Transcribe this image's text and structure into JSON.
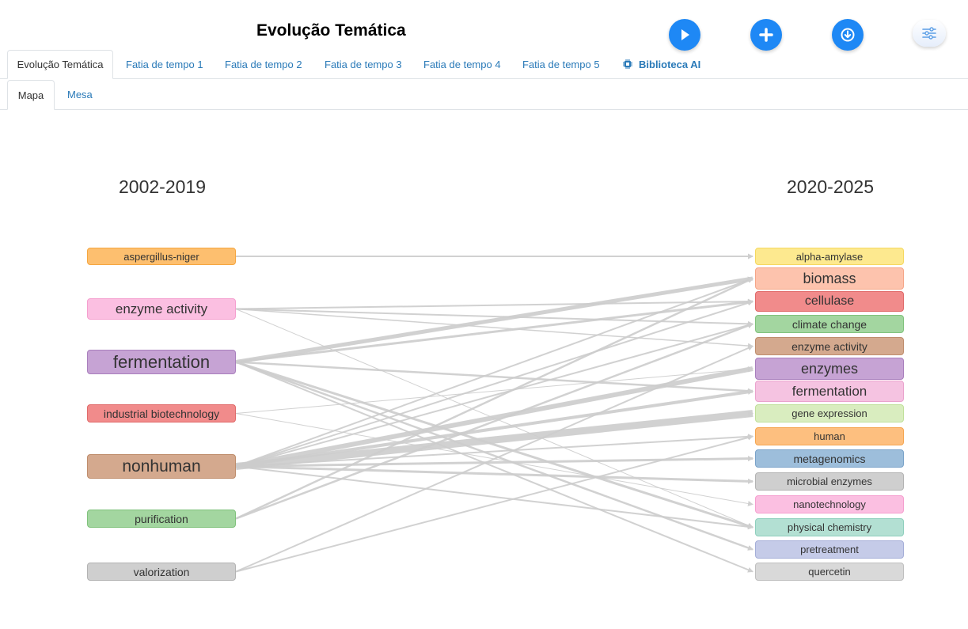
{
  "header": {
    "title": "Evolução Temática"
  },
  "toolbar": {
    "buttons": [
      {
        "name": "play-button",
        "icon": "play-icon"
      },
      {
        "name": "add-button",
        "icon": "plus-icon"
      },
      {
        "name": "download-button",
        "icon": "download-icon"
      },
      {
        "name": "settings-button",
        "icon": "sliders-icon"
      }
    ]
  },
  "tabs": [
    {
      "label": "Evolução Temática",
      "active": true
    },
    {
      "label": "Fatia de tempo 1",
      "active": false
    },
    {
      "label": "Fatia de tempo 2",
      "active": false
    },
    {
      "label": "Fatia de tempo 3",
      "active": false
    },
    {
      "label": "Fatia de tempo 4",
      "active": false
    },
    {
      "label": "Fatia de tempo 5",
      "active": false
    },
    {
      "label": "Biblioteca AI",
      "active": false,
      "icon": "chip-icon"
    }
  ],
  "subtabs": [
    {
      "label": "Mapa",
      "active": true
    },
    {
      "label": "Mesa",
      "active": false
    }
  ],
  "map": {
    "left_period": "2002-2019",
    "right_period": "2020-2025",
    "left_nodes": [
      {
        "label": "aspergillus-niger",
        "color": "#fdbf6f",
        "border": "#f5a640"
      },
      {
        "label": "enzyme activity",
        "color": "#fbbfe1",
        "border": "#f59fcf"
      },
      {
        "label": "fermentation",
        "color": "#c6a3d4",
        "border": "#a97fbd"
      },
      {
        "label": "industrial biotechnology",
        "color": "#f18b8b",
        "border": "#e06a6a"
      },
      {
        "label": "nonhuman",
        "color": "#d4a98e",
        "border": "#bf8d6c"
      },
      {
        "label": "purification",
        "color": "#a3d6a0",
        "border": "#80c27c"
      },
      {
        "label": "valorization",
        "color": "#cfcfcf",
        "border": "#b3b3b3"
      }
    ],
    "right_nodes": [
      {
        "label": "alpha-amylase",
        "color": "#fde98f",
        "border": "#f5d860"
      },
      {
        "label": "biomass",
        "color": "#fdc3ad",
        "border": "#f5a688"
      },
      {
        "label": "cellulase",
        "color": "#f18b8b",
        "border": "#e06a6a"
      },
      {
        "label": "climate change",
        "color": "#a3d6a0",
        "border": "#80c27c"
      },
      {
        "label": "enzyme activity",
        "color": "#d4a98e",
        "border": "#bf8d6c"
      },
      {
        "label": "enzymes",
        "color": "#c6a3d4",
        "border": "#a97fbd"
      },
      {
        "label": "fermentation",
        "color": "#f5c3e1",
        "border": "#eaa3cd"
      },
      {
        "label": "gene expression",
        "color": "#d9edbf",
        "border": "#c0e09a"
      },
      {
        "label": "human",
        "color": "#fdbf7f",
        "border": "#f5a650"
      },
      {
        "label": "metagenomics",
        "color": "#9dbedb",
        "border": "#7aa3c9"
      },
      {
        "label": "microbial enzymes",
        "color": "#cfcfcf",
        "border": "#b3b3b3"
      },
      {
        "label": "nanotechnology",
        "color": "#fbbfe1",
        "border": "#f59fcf"
      },
      {
        "label": "physical chemistry",
        "color": "#b3e0d3",
        "border": "#8fcfbd"
      },
      {
        "label": "pretreatment",
        "color": "#c5cbe8",
        "border": "#a5aed8"
      },
      {
        "label": "quercetin",
        "color": "#d9d9d9",
        "border": "#bfbfbf"
      }
    ],
    "flow_color": "#cccccc"
  }
}
